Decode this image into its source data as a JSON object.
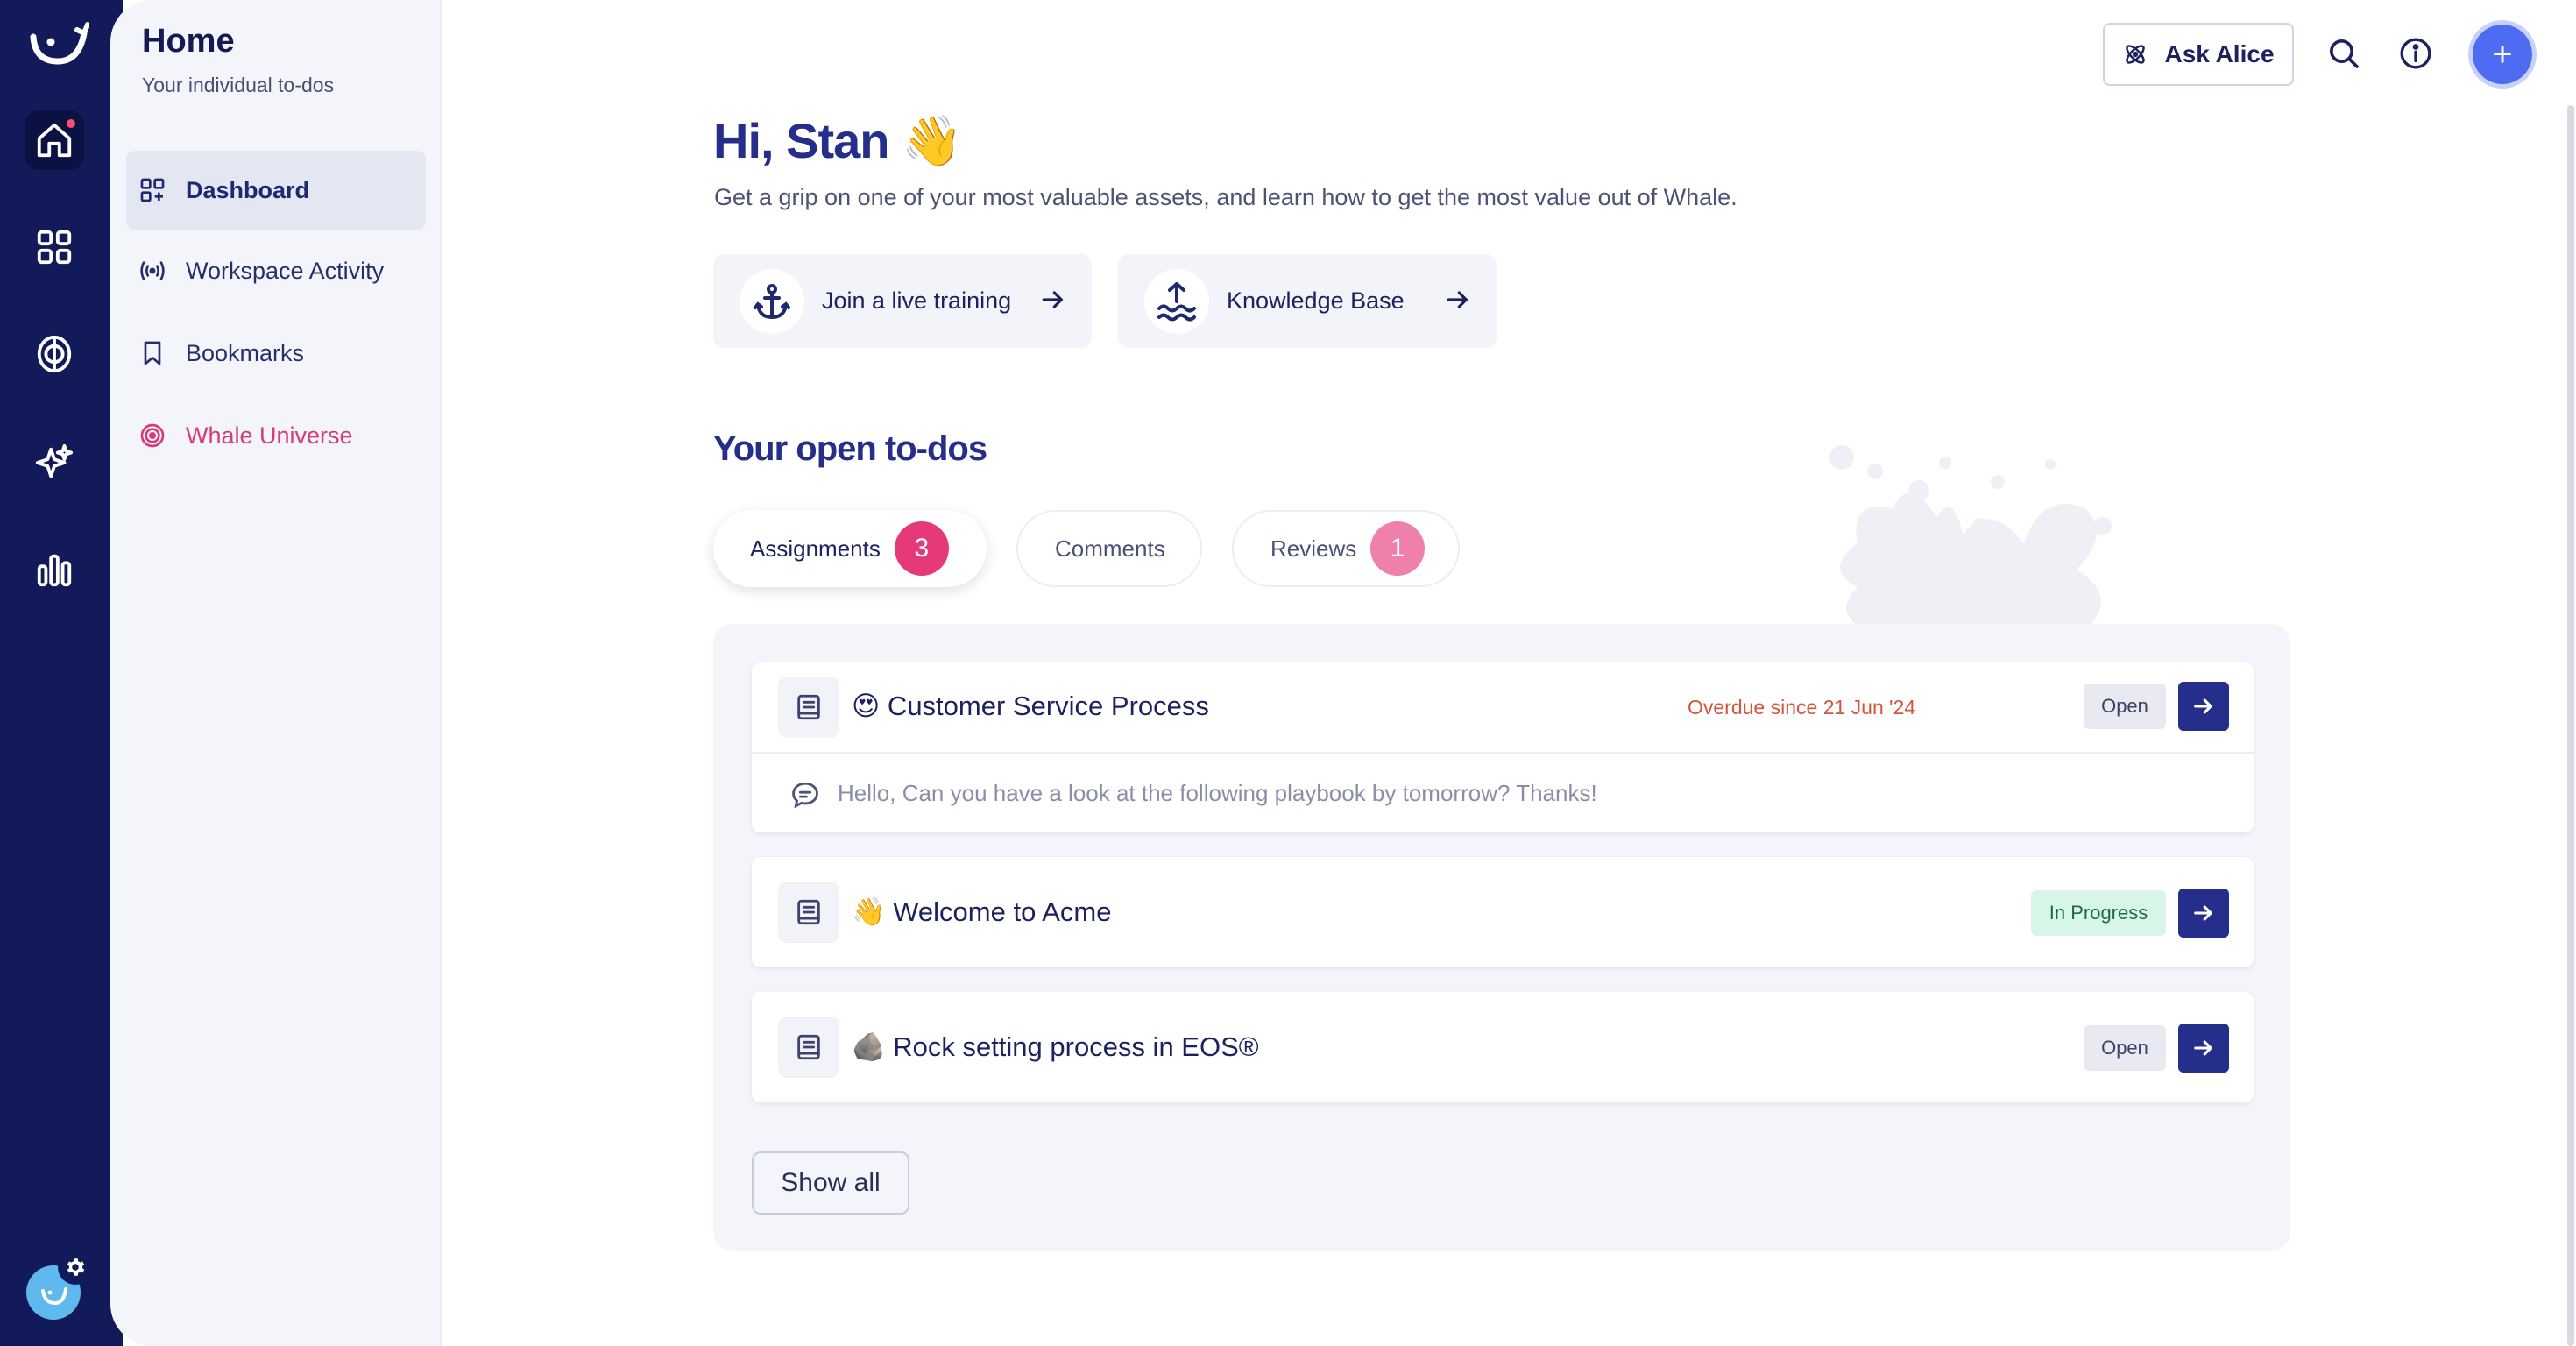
{
  "sidebar": {
    "title": "Home",
    "subtitle": "Your individual to-dos",
    "items": [
      {
        "label": "Dashboard"
      },
      {
        "label": "Workspace Activity"
      },
      {
        "label": "Bookmarks"
      },
      {
        "label": "Whale Universe"
      }
    ]
  },
  "toolbar": {
    "ask_label": "Ask Alice",
    "plus_label": "+"
  },
  "main": {
    "greeting": "Hi, Stan 👋",
    "subtitle": "Get a grip on one of your most valuable assets, and learn how to get the most value out of Whale.",
    "links": [
      {
        "label": "Join a live training"
      },
      {
        "label": "Knowledge Base"
      }
    ],
    "todos_title": "Your open to-dos",
    "tabs": [
      {
        "label": "Assignments",
        "count": "3"
      },
      {
        "label": "Comments"
      },
      {
        "label": "Reviews",
        "count": "1"
      }
    ],
    "tasks": [
      {
        "title": "😍 Customer Service Process",
        "overdue": "Overdue since 21 Jun '24",
        "status": "Open",
        "comment": "Hello, Can you have a look at the following playbook by tomorrow? Thanks!"
      },
      {
        "title": "👋 Welcome to Acme",
        "status": "In Progress"
      },
      {
        "title": "🪨 Rock setting process in EOS®",
        "status": "Open"
      }
    ],
    "show_all": "Show all"
  },
  "colors": {
    "rail": "#131a5a",
    "accent": "#262e8c",
    "pink": "#e6397a",
    "pink_light": "#ef7fab",
    "overdue": "#d5543e",
    "plus": "#4d6cf2"
  }
}
